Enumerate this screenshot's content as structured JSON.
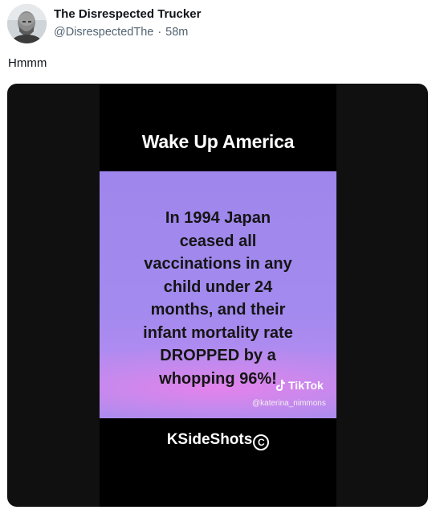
{
  "author": {
    "display_name": "The Disrespected Trucker",
    "handle": "@DisrespectedThe",
    "separator": "·",
    "timestamp": "58m"
  },
  "post": {
    "text": "Hmmm"
  },
  "media": {
    "title": "Wake Up America",
    "message": "In 1994 Japan\nceased all\nvaccinations in any\nchild under 24\nmonths, and their\ninfant mortality rate\nDROPPED by a\nwhopping 96%!",
    "tiktok_label": "TikTok",
    "tiktok_handle": "@katerina_nimmons",
    "brand": "KSideShots",
    "copyright_symbol": "C",
    "icons": [
      "tiktok-logo-icon",
      "copyright-icon"
    ],
    "colors": {
      "card_purple": "#a28aee",
      "card_pink_glow": "#e682eb",
      "frame_black": "#000000"
    }
  }
}
